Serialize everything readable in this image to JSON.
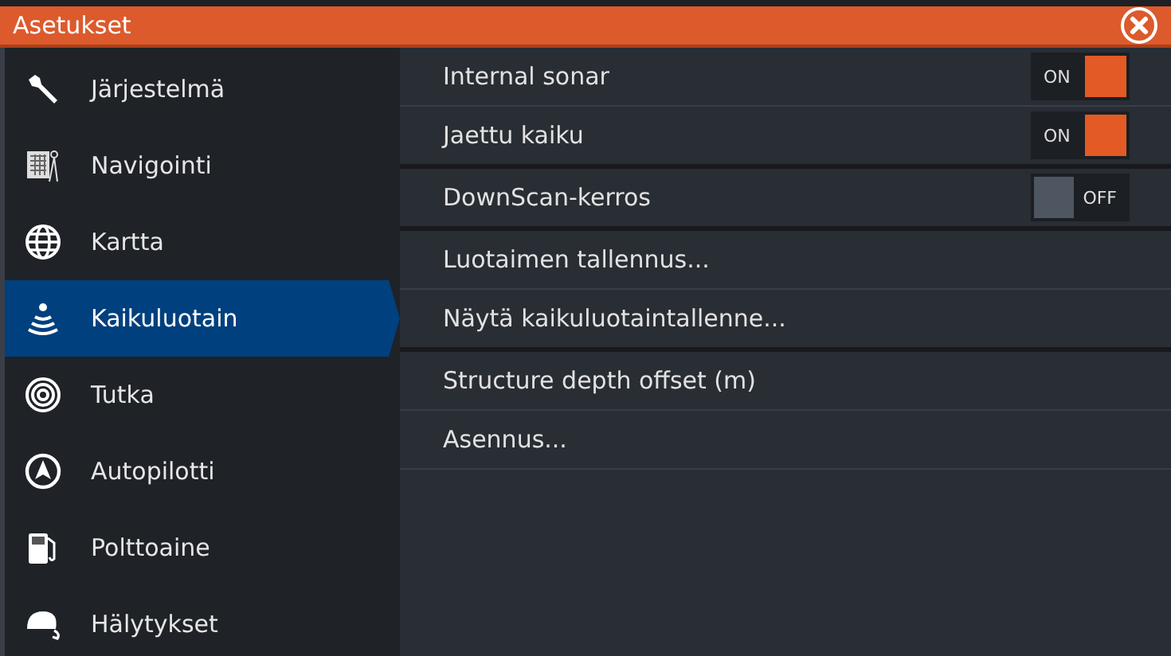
{
  "window": {
    "title": "Asetukset"
  },
  "sidebar": {
    "items": [
      {
        "label": "Järjestelmä",
        "selected": false
      },
      {
        "label": "Navigointi",
        "selected": false
      },
      {
        "label": "Kartta",
        "selected": false
      },
      {
        "label": "Kaikuluotain",
        "selected": true
      },
      {
        "label": "Tutka",
        "selected": false
      },
      {
        "label": "Autopilotti",
        "selected": false
      },
      {
        "label": "Polttoaine",
        "selected": false
      },
      {
        "label": "Hälytykset",
        "selected": false
      }
    ]
  },
  "settings": [
    {
      "kind": "toggle",
      "label": "Internal sonar",
      "on": true,
      "state_text": "ON",
      "group_end": false
    },
    {
      "kind": "toggle",
      "label": "Jaettu kaiku",
      "on": true,
      "state_text": "ON",
      "group_end": true
    },
    {
      "kind": "toggle",
      "label": "DownScan-kerros",
      "on": false,
      "state_text": "OFF",
      "group_end": true
    },
    {
      "kind": "action",
      "label": "Luotaimen tallennus...",
      "group_end": false
    },
    {
      "kind": "action",
      "label": "Näytä kaikuluotaintallenne...",
      "group_end": true
    },
    {
      "kind": "action",
      "label": "Structure depth offset (m)",
      "group_end": false
    },
    {
      "kind": "action",
      "label": "Asennus...",
      "group_end": false
    }
  ]
}
